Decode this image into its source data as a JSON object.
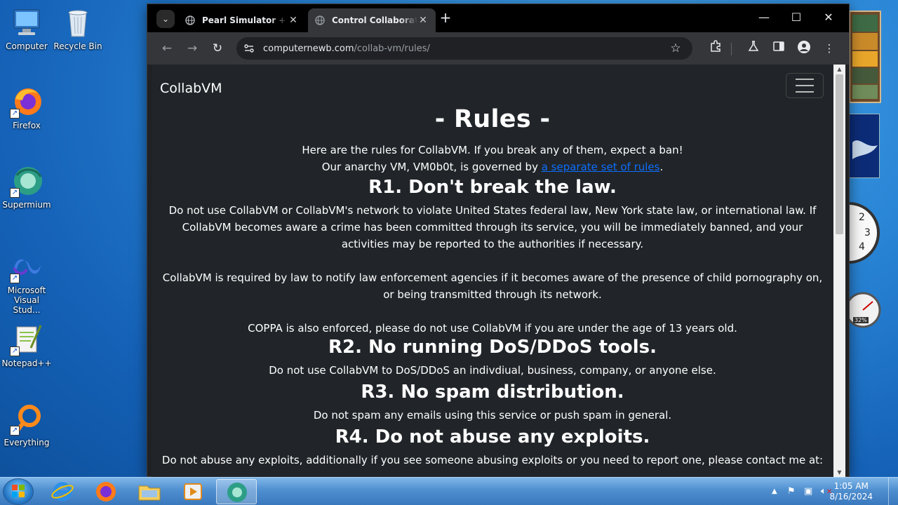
{
  "desktop": {
    "icons": [
      {
        "label": "Computer"
      },
      {
        "label": "Recycle Bin"
      },
      {
        "label": "Firefox"
      },
      {
        "label": "Supermium"
      },
      {
        "label": "Microsoft Visual Stud..."
      },
      {
        "label": "Notepad++"
      },
      {
        "label": "Everything"
      }
    ],
    "gadget_cpu": "32%",
    "clock_numbers": [
      "2",
      "3",
      "4"
    ]
  },
  "browser": {
    "tabs": [
      {
        "title": "Pearl Simulator + Wi",
        "active": false
      },
      {
        "title": "Control Collaborative",
        "active": true
      }
    ],
    "url_host": "computernewb.com",
    "url_path": "/collab-vm/rules/"
  },
  "page": {
    "brand": "CollabVM",
    "heading": "- Rules -",
    "intro1": "Here are the rules for CollabVM. If you break any of them, expect a ban!",
    "intro2_pre": "Our anarchy VM, VM0b0t, is governed by ",
    "intro2_link": "a separate set of rules",
    "intro2_post": ".",
    "rules": [
      {
        "title": "R1. Don't break the law.",
        "paragraphs": [
          "Do not use CollabVM or CollabVM's network to violate United States federal law, New York state law, or international law. If CollabVM becomes aware a crime has been committed through its service, you will be immediately banned, and your activities may be reported to the authorities if necessary.",
          "CollabVM is required by law to notify law enforcement agencies if it becomes aware of the presence of child pornography on, or being transmitted through its network.",
          "COPPA is also enforced, please do not use CollabVM if you are under the age of 13 years old."
        ]
      },
      {
        "title": "R2. No running DoS/DDoS tools.",
        "paragraphs": [
          "Do not use CollabVM to DoS/DDoS an indivdiual, business, company, or anyone else."
        ]
      },
      {
        "title": "R3. No spam distribution.",
        "paragraphs": [
          "Do not spam any emails using this service or push spam in general."
        ]
      },
      {
        "title": "R4. Do not abuse any exploits.",
        "paragraphs": [
          "Do not abuse any exploits, additionally if you see someone abusing exploits or you need to report one, please contact me at:"
        ]
      }
    ]
  },
  "taskbar": {
    "time": "1:05 AM",
    "date": "8/16/2024"
  }
}
